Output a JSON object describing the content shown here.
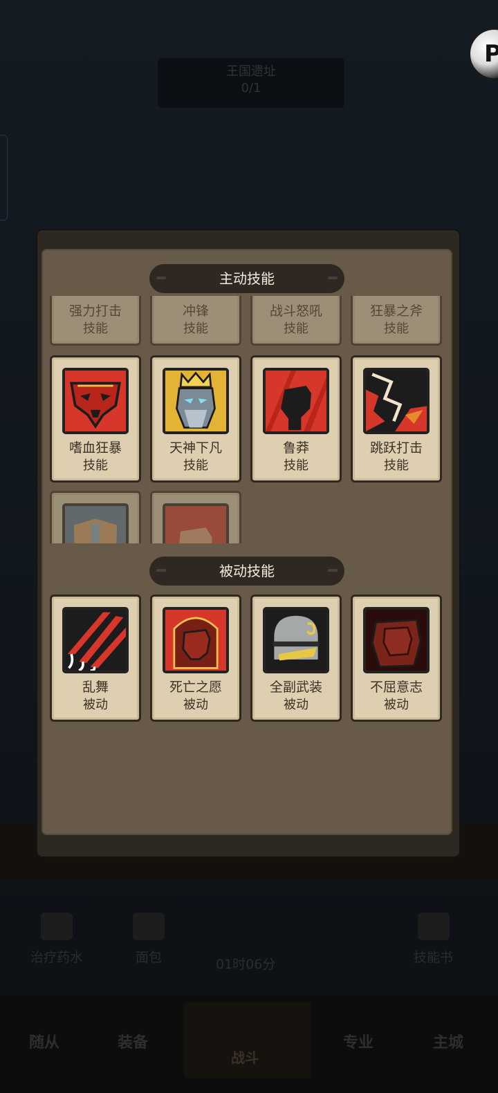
{
  "background": {
    "top_card": {
      "title": "王国遗址",
      "progress": "0/1"
    },
    "items": [
      {
        "label": "治疗药水"
      },
      {
        "label": "面包"
      },
      {
        "label": "01时06分"
      },
      {
        "label": "技能书"
      }
    ],
    "nav": [
      {
        "label": "随从"
      },
      {
        "label": "装备"
      },
      {
        "label": "战斗"
      },
      {
        "label": "专业"
      },
      {
        "label": "主城"
      }
    ],
    "avatar_letter": "P"
  },
  "popup": {
    "active_title": "主动技能",
    "passive_title": "被动技能",
    "active_row_cut": [
      {
        "name": "强力打击",
        "sub": "技能"
      },
      {
        "name": "冲锋",
        "sub": "技能"
      },
      {
        "name": "战斗怒吼",
        "sub": "技能"
      },
      {
        "name": "狂暴之斧",
        "sub": "技能"
      }
    ],
    "active_row": [
      {
        "name": "嗜血狂暴",
        "sub": "技能",
        "icon": "bloodlust-mask-icon"
      },
      {
        "name": "天神下凡",
        "sub": "技能",
        "icon": "god-king-icon"
      },
      {
        "name": "鲁莽",
        "sub": "技能",
        "icon": "fist-icon"
      },
      {
        "name": "跳跃打击",
        "sub": "技能",
        "icon": "leap-strike-icon"
      }
    ],
    "active_row_faded": [
      {
        "icon": "warrior-helm-icon"
      },
      {
        "icon": "flame-fist-icon"
      }
    ],
    "passive_row": [
      {
        "name": "乱舞",
        "sub": "被动",
        "icon": "claw-slash-icon"
      },
      {
        "name": "死亡之愿",
        "sub": "被动",
        "icon": "death-wish-fist-icon"
      },
      {
        "name": "全副武装",
        "sub": "被动",
        "icon": "armored-helm-icon"
      },
      {
        "name": "不屈意志",
        "sub": "被动",
        "icon": "iron-will-fist-icon"
      }
    ]
  },
  "colors": {
    "panel": "#675a48",
    "card": "#ddcfb0",
    "banner": "#2f2822",
    "red": "#d6372a"
  }
}
